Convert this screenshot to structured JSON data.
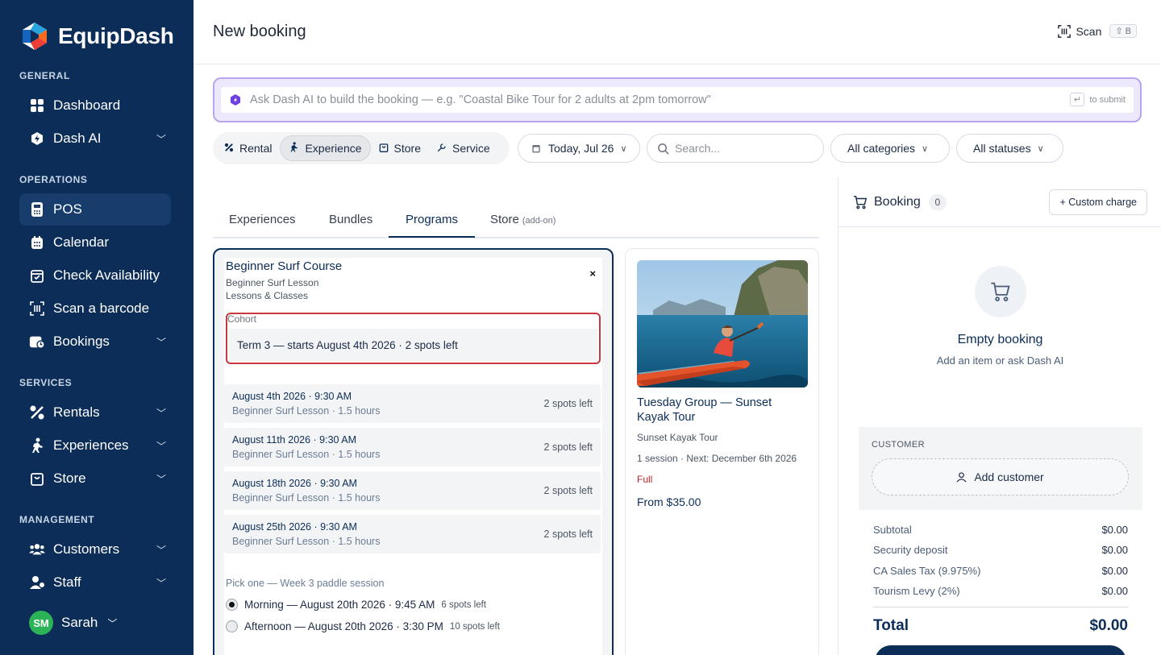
{
  "app": {
    "name": "EquipDash"
  },
  "colors": {
    "brand_navy": "#0b2d57",
    "accent_purple": "#b8a6f0",
    "status_full": "#c0262d",
    "avatar_green": "#2db357",
    "highlight_red": "#c8363f"
  },
  "sidebar": {
    "sections": [
      {
        "title": "GENERAL"
      },
      {
        "title": "OPERATIONS"
      },
      {
        "title": "SERVICES"
      },
      {
        "title": "MANAGEMENT"
      }
    ],
    "items": [
      {
        "label": "Dashboard",
        "icon": "grid-icon"
      },
      {
        "label": "Dash AI",
        "icon": "ai-shield-icon"
      },
      {
        "label": "POS",
        "icon": "pos-terminal-icon"
      },
      {
        "label": "Calendar",
        "icon": "calendar-icon"
      },
      {
        "label": "Check Availability",
        "icon": "calendar-check-icon"
      },
      {
        "label": "Scan a barcode",
        "icon": "barcode-scan-icon"
      },
      {
        "label": "Bookings",
        "icon": "bookings-icon"
      },
      {
        "label": "Rentals",
        "icon": "rentals-icon"
      },
      {
        "label": "Experiences",
        "icon": "experiences-icon"
      },
      {
        "label": "Store",
        "icon": "store-bag-icon"
      },
      {
        "label": "Customers",
        "icon": "customers-icon"
      },
      {
        "label": "Staff",
        "icon": "staff-icon"
      }
    ],
    "user": {
      "initials": "SM",
      "name": "Sarah"
    }
  },
  "header": {
    "title": "New booking",
    "scan_label": "Scan",
    "scan_shortcut": "⇧ B"
  },
  "ai_bar": {
    "placeholder": "Ask Dash AI to build the booking — e.g. \"Coastal Bike Tour for 2 adults at 2pm tomorrow\"",
    "submit_key": "↵",
    "submit_hint": "to submit"
  },
  "type_tabs": [
    {
      "label": "Rental",
      "icon": "rental-icon"
    },
    {
      "label": "Experience",
      "icon": "experience-icon",
      "active": true
    },
    {
      "label": "Store",
      "icon": "store-icon"
    },
    {
      "label": "Service",
      "icon": "wrench-icon"
    }
  ],
  "filters": {
    "date": "Today, Jul 26",
    "search_placeholder": "Search...",
    "categories": "All categories",
    "statuses": "All statuses"
  },
  "subtabs": [
    {
      "label": "Experiences"
    },
    {
      "label": "Bundles"
    },
    {
      "label": "Programs",
      "active": true
    },
    {
      "label": "Store",
      "suffix": "(add-on)"
    }
  ],
  "program_card": {
    "title": "Beginner Surf Course",
    "subtitle": "Beginner Surf Lesson",
    "category": "Lessons & Classes",
    "close": "×",
    "cohort_label": "Cohort",
    "cohort_value": "Term 3 — starts August 4th 2026 · 2 spots left",
    "sessions": [
      {
        "when": "August 4th 2026 · 9:30 AM",
        "detail": "Beginner Surf Lesson · 1.5 hours",
        "spots": "2 spots left"
      },
      {
        "when": "August 11th 2026 · 9:30 AM",
        "detail": "Beginner Surf Lesson · 1.5 hours",
        "spots": "2 spots left"
      },
      {
        "when": "August 18th 2026 · 9:30 AM",
        "detail": "Beginner Surf Lesson · 1.5 hours",
        "spots": "2 spots left"
      },
      {
        "when": "August 25th 2026 · 9:30 AM",
        "detail": "Beginner Surf Lesson · 1.5 hours",
        "spots": "2 spots left"
      }
    ],
    "pick_title": "Pick one — Week 3 paddle session",
    "options": [
      {
        "label": "Morning — August 20th 2026 · 9:45 AM",
        "spots": "6 spots left",
        "selected": true
      },
      {
        "label": "Afternoon — August 20th 2026 · 3:30 PM",
        "spots": "10 spots left",
        "selected": false
      }
    ]
  },
  "side_card": {
    "title": "Tuesday Group — Sunset Kayak Tour",
    "subtitle": "Sunset Kayak Tour",
    "sessions": "1 session · Next: December 6th 2026",
    "status": "Full",
    "price": "From $35.00"
  },
  "booking": {
    "title": "Booking",
    "count": "0",
    "custom_charge": "+ Custom charge",
    "empty_title": "Empty booking",
    "empty_sub": "Add an item or ask Dash AI",
    "customer_label": "CUSTOMER",
    "add_customer": "Add customer",
    "summary": [
      {
        "label": "Subtotal",
        "value": "$0.00"
      },
      {
        "label": "Security deposit",
        "value": "$0.00"
      },
      {
        "label": "CA Sales Tax (9.975%)",
        "value": "$0.00"
      },
      {
        "label": "Tourism Levy (2%)",
        "value": "$0.00"
      }
    ],
    "total_label": "Total",
    "total_value": "$0.00"
  }
}
